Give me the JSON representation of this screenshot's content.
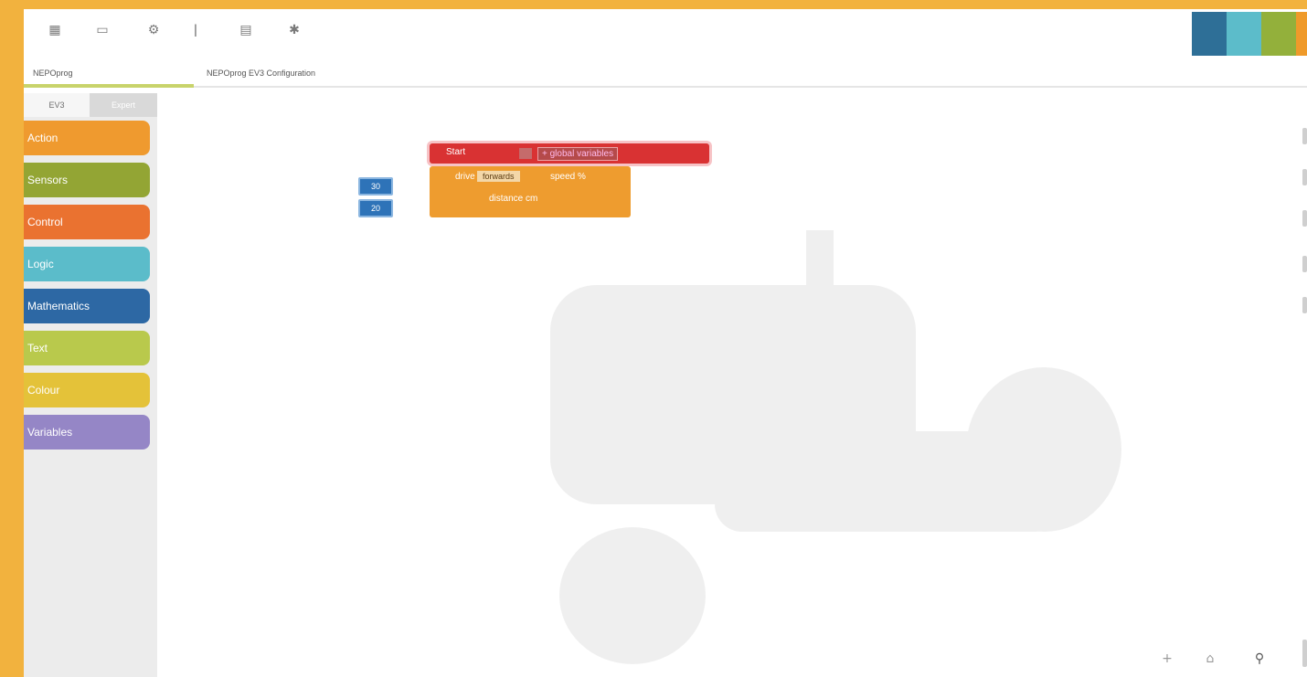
{
  "toolbar": {
    "icons": [
      "new-program-icon",
      "open-icon",
      "settings-icon",
      "info-icon",
      "connect-icon",
      "help-icon"
    ],
    "logo_colors": [
      "#2e6f97",
      "#5cbcca",
      "#93b03b",
      "#ef9a2a"
    ]
  },
  "tabs": {
    "program_tab": "NEPOprog",
    "config_tab": "NEPOprog EV3 Configuration"
  },
  "sidebar": {
    "tabs": [
      "EV3",
      "Expert"
    ],
    "categories": [
      {
        "label": "Action",
        "color": "#ef9a2f"
      },
      {
        "label": "Sensors",
        "color": "#93a534"
      },
      {
        "label": "Control",
        "color": "#ea7230"
      },
      {
        "label": "Logic",
        "color": "#5bbcca"
      },
      {
        "label": "Mathematics",
        "color": "#2d68a4"
      },
      {
        "label": "Text",
        "color": "#b9c94c"
      },
      {
        "label": "Colour",
        "color": "#e4c239"
      },
      {
        "label": "Variables",
        "color": "#9586c6"
      }
    ]
  },
  "blocks": {
    "start": {
      "label": "Start",
      "variables": "+ global variables",
      "color": "#d93233"
    },
    "drive": {
      "label": "drive",
      "direction": "forwards",
      "speed_label": "speed %",
      "distance_label": "distance cm",
      "color": "#ee9c2f"
    },
    "speed_value": "30",
    "distance_value": "20"
  }
}
